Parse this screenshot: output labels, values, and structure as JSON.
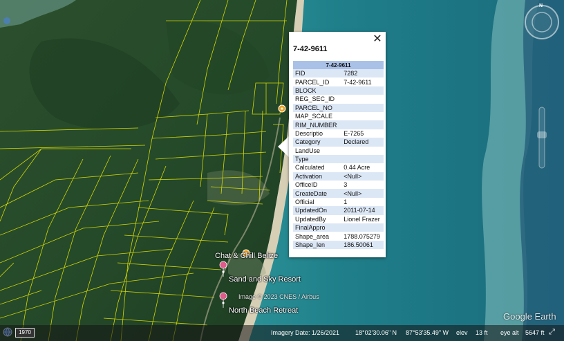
{
  "popup": {
    "title": "7-42-9611",
    "table_header": "7-42-9611",
    "close_symbol": "✕",
    "rows": [
      {
        "k": "FID",
        "v": "7282"
      },
      {
        "k": "PARCEL_ID",
        "v": "7-42-9611"
      },
      {
        "k": "BLOCK",
        "v": ""
      },
      {
        "k": "REG_SEC_ID",
        "v": ""
      },
      {
        "k": "PARCEL_NO",
        "v": ""
      },
      {
        "k": "MAP_SCALE",
        "v": ""
      },
      {
        "k": "RIM_NUMBER",
        "v": ""
      },
      {
        "k": "Descriptio",
        "v": "E-7265"
      },
      {
        "k": "Category",
        "v": "Declared"
      },
      {
        "k": "LandUse",
        "v": ""
      },
      {
        "k": "Type",
        "v": ""
      },
      {
        "k": "Calculated",
        "v": "0.44 Acre"
      },
      {
        "k": "Activation",
        "v": "<Null>"
      },
      {
        "k": "OfficeID",
        "v": "3"
      },
      {
        "k": "CreateDate",
        "v": "<Null>"
      },
      {
        "k": "Official",
        "v": "1"
      },
      {
        "k": "UpdatedOn",
        "v": "2011-07-14"
      },
      {
        "k": "UpdatedBy",
        "v": "Lionel Frazer"
      },
      {
        "k": "FinalAppro",
        "v": ""
      },
      {
        "k": "Shape_area",
        "v": "1788.075279"
      },
      {
        "k": "Shape_len",
        "v": "186.50061"
      }
    ]
  },
  "places": {
    "chat_chill": "Chat & Chill Belize",
    "sand_sky": "Sand and Sky Resort",
    "north_beach": "North Beach Retreat"
  },
  "imagery_credit": "Image © 2023 CNES / Airbus",
  "status": {
    "imagery_date": "Imagery Date: 1/26/2021",
    "lat": "18°02'30.06\" N",
    "lon": "87°53'35.49\" W",
    "elev_label": "elev",
    "elev_value": "13 ft",
    "eye_label": "eye alt",
    "eye_value": "5647 ft"
  },
  "history_year": "1970",
  "logo": "Google Earth",
  "compass_north": "N",
  "colors": {
    "parcel_lines": "#e6e600",
    "popup_header": "#a9c1e6",
    "popup_stripe": "#dce7f6",
    "pin_orange": "#f0a020",
    "pin_pink": "#e05a8a"
  }
}
